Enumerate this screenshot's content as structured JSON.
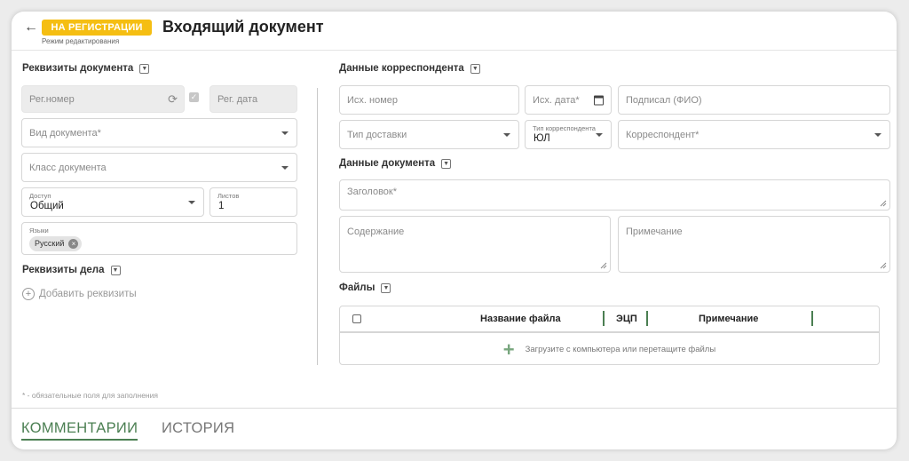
{
  "header": {
    "back_icon": "arrow-left-icon",
    "status_badge": "НА РЕГИСТРАЦИИ",
    "status_color": "#f5be12",
    "mode": "Режим редактирования",
    "title": "Входящий документ"
  },
  "doc_requisites": {
    "title": "Реквизиты документа",
    "reg_number_placeholder": "Рег.номер",
    "reg_date_placeholder": "Рег. дата",
    "doc_type_placeholder": "Вид документа*",
    "doc_class_placeholder": "Класс документа",
    "access_label": "Доступ",
    "access_value": "Общий",
    "sheets_label": "Листов",
    "sheets_value": "1",
    "languages_label": "Языки",
    "language_chip": "Русский"
  },
  "case_requisites": {
    "title": "Реквизиты дела",
    "add_label": "Добавить реквизиты"
  },
  "correspondent": {
    "title": "Данные корреспондента",
    "out_number_placeholder": "Исх. номер",
    "out_date_placeholder": "Исх. дата*",
    "signed_by_placeholder": "Подписал (ФИО)",
    "delivery_type_placeholder": "Тип доставки",
    "corr_type_label": "Тип корреспондента",
    "corr_type_value": "ЮЛ",
    "correspondent_placeholder": "Корреспондент*"
  },
  "document_data": {
    "title": "Данные документа",
    "heading_placeholder": "Заголовок*",
    "content_placeholder": "Содержание",
    "note_placeholder": "Примечание"
  },
  "files": {
    "title": "Файлы",
    "columns": [
      "Название файла",
      "ЭЦП",
      "Примечание"
    ],
    "upload_text": "Загрузите с компьютера или перетащите файлы"
  },
  "required_note": "* - обязательные поля для заполнения",
  "tabs": [
    {
      "label": "КОММЕНТАРИИ",
      "active": true
    },
    {
      "label": "ИСТОРИЯ",
      "active": false
    }
  ],
  "accent_color": "#4b7f52"
}
